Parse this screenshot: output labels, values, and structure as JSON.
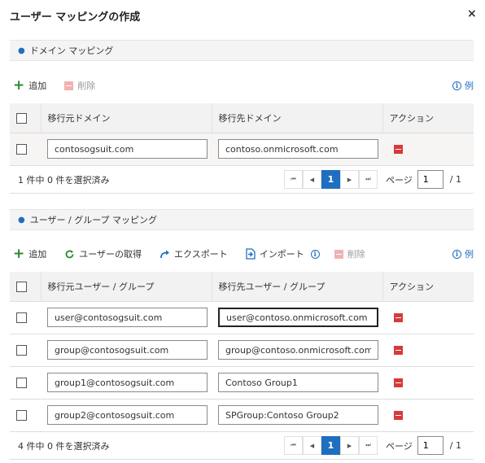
{
  "dialog": {
    "title": "ユーザー マッピングの作成",
    "close": "×"
  },
  "domain_section": {
    "header": "ドメイン マッピング",
    "toolbar": {
      "add": "追加",
      "delete": "削除",
      "example": "例"
    },
    "columns": {
      "source": "移行元ドメイン",
      "target": "移行先ドメイン",
      "action": "アクション"
    },
    "rows": [
      {
        "source": "contosogsuit.com",
        "target": "contoso.onmicrosoft.com"
      }
    ],
    "status": "1 件中 0 件を選択済み",
    "pager": {
      "first": "⏮",
      "prev": "◀",
      "current": "1",
      "next": "▶",
      "last": "⏭",
      "page_label": "ページ",
      "page_value": "1",
      "total": "/  1"
    }
  },
  "user_section": {
    "header": "ユーザー / グループ マッピング",
    "toolbar": {
      "add": "追加",
      "get_users": "ユーザーの取得",
      "export": "エクスポート",
      "import": "インポート",
      "delete": "削除",
      "example": "例"
    },
    "columns": {
      "source": "移行元ユーザー / グループ",
      "target": "移行先ユーザー / グループ",
      "action": "アクション"
    },
    "rows": [
      {
        "source": "user@contosogsuit.com",
        "target": "user@contoso.onmicrosoft.com"
      },
      {
        "source": "group@contosogsuit.com",
        "target": "group@contoso.onmicrosoft.com"
      },
      {
        "source": "group1@contosogsuit.com",
        "target": "Contoso Group1"
      },
      {
        "source": "group2@contosogsuit.com",
        "target": "SPGroup:Contoso Group2"
      }
    ],
    "status": "4 件中 0 件を選択済み",
    "pager": {
      "first": "⏮",
      "prev": "◀",
      "current": "1",
      "next": "▶",
      "last": "⏭",
      "page_label": "ページ",
      "page_value": "1",
      "total": "/  1"
    }
  },
  "colors": {
    "accent": "#1f6fbf",
    "add_green": "#2e8b2e",
    "delete_red": "#d63a3a"
  }
}
